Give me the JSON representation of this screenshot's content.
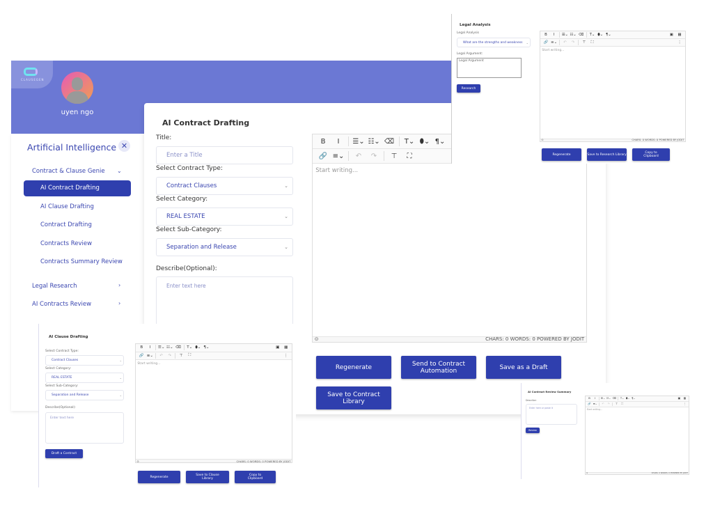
{
  "brand": {
    "logo_text": "CLAUSEGEN"
  },
  "user": {
    "name": "uyen ngo"
  },
  "sidebar": {
    "title": "Artificial Intelligence",
    "groups": [
      {
        "label": "Contract & Clause Genie",
        "items": [
          "AI Contract Drafting",
          "AI Clause Drafting",
          "Contract Drafting",
          "Contracts Review",
          "Contracts Summary Review"
        ]
      },
      {
        "label": "Legal Research"
      },
      {
        "label": "AI Contracts Review"
      }
    ]
  },
  "editor": {
    "placeholder": "Start writing...",
    "status": "CHARS: 0   WORDS: 0   POWERED BY JODIT"
  },
  "contract_drafting": {
    "title": "AI Contract Drafting",
    "title_label": "Title:",
    "title_placeholder": "Enter a Title",
    "type_label": "Select Contract Type:",
    "type_value": "Contract Clauses",
    "category_label": "Select Category:",
    "category_value": "REAL ESTATE",
    "subcategory_label": "Select Sub-Category:",
    "subcategory_value": "Separation and Release",
    "describe_label": "Describe(Optional):",
    "describe_placeholder": "Enter text here",
    "buttons": [
      "Regenerate",
      "Send to Contract Automation",
      "Save as a Draft",
      "Save to Contract Library"
    ]
  },
  "legal_analysis": {
    "title": "Legal Analysis",
    "analysis_label": "Legal Analysis",
    "analysis_value": "What are the strengths and weakness",
    "argument_label": "Legal Argument:",
    "argument_placeholder": "Legal Argument",
    "research_button": "Research",
    "buttons": [
      "Regenerate",
      "Save to Research Library",
      "Copy to Clipboard"
    ]
  },
  "clause_drafting": {
    "title": "AI Clause Drafting",
    "type_label": "Select Contract Type:",
    "type_value": "Contract Clauses",
    "category_label": "Select Category:",
    "category_value": "REAL ESTATE",
    "subcategory_label": "Select Sub-Category:",
    "subcategory_value": "Separation and Release",
    "describe_label": "Describe(Optional):",
    "describe_placeholder": "Enter text here",
    "draft_button": "Draft a Contract",
    "buttons": [
      "Regenerate",
      "Save to Clause Library",
      "Copy to Clipboard"
    ]
  },
  "review_summary": {
    "title": "AI Contract Review Summary",
    "describe_label": "Describe:",
    "describe_placeholder": "Enter here or paste it",
    "review_button": "Review"
  },
  "colors": {
    "header": "#6b78d4",
    "primary": "#2f3fae",
    "accent_text": "#3a46b0"
  }
}
